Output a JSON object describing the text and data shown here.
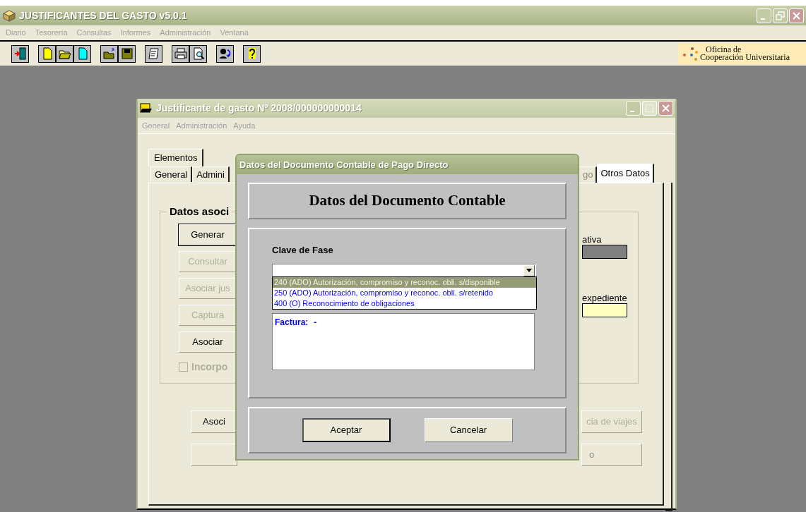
{
  "app_window": {
    "title": "JUSTIFICANTES DEL GASTO v5.0.1",
    "menu": [
      "Diario",
      "Tesorería",
      "Consultas",
      "Informes",
      "Administración",
      "Ventana"
    ],
    "toolbar": [
      {
        "kind": "exit"
      },
      {
        "kind": "new"
      },
      {
        "kind": "open"
      },
      {
        "kind": "new-alt"
      },
      {
        "kind": "folder-up"
      },
      {
        "kind": "save"
      },
      {
        "kind": "notes"
      },
      {
        "kind": "print"
      },
      {
        "kind": "preview"
      },
      {
        "kind": "users"
      },
      {
        "kind": "help"
      }
    ],
    "logo": {
      "line_1": "Oficina de",
      "line_2": "Cooperación Universitaria"
    }
  },
  "document_window": {
    "title": "Justificante de gasto Nº 2008/000000000014",
    "menu": [
      "General",
      "Administración",
      "Ayuda"
    ],
    "tabs_row_1": [
      {
        "label": "Elementos",
        "selected": false
      }
    ],
    "tabs_row_2_left": [
      {
        "label": "General",
        "selected": false
      },
      {
        "label": "Admini",
        "selected": false
      }
    ],
    "tabs_row_2_right": [
      {
        "label": "go",
        "selected": false,
        "disabled": true
      },
      {
        "label": "Otros Datos",
        "selected": true,
        "disabled": false
      }
    ],
    "group_title": "Datos asoci",
    "left_buttons": [
      {
        "label": "Generar",
        "disabled": false,
        "default": true
      },
      {
        "label": "Consultar",
        "disabled": true,
        "default": false
      },
      {
        "label": "Asociar jus",
        "disabled": true,
        "default": false
      },
      {
        "label": "Captura",
        "disabled": true,
        "default": false
      },
      {
        "label": "Asociar",
        "disabled": false,
        "default": false
      }
    ],
    "checkbox": {
      "label": "Incorpo",
      "checked": false,
      "disabled": true
    },
    "right_fields": [
      {
        "label": "ativa",
        "disabled": true
      },
      {
        "label": "expediente",
        "disabled": false
      }
    ],
    "bottom_row_1": [
      {
        "label": "Asoci",
        "disabled": false
      },
      {
        "label": "cia de viajes",
        "disabled": true
      }
    ],
    "bottom_row_2": [
      {
        "label": "o",
        "disabled": true
      }
    ]
  },
  "dialog": {
    "title": "Datos del Documento Contable de Pago Directo",
    "heading": "Datos del Documento Contable",
    "field_label": "Clave de Fase",
    "options": [
      {
        "label": "240 (ADO) Autorización, compromiso y reconoc. obli. s/disponible",
        "selected": true
      },
      {
        "label": "250 (ADO) Autorización, compromiso y reconoc. obli. s/retenido",
        "selected": false
      },
      {
        "label": "400 (O) Reconocimiento de obligaciones",
        "selected": false
      }
    ],
    "details": [
      {
        "label": "Factura:",
        "value": "-"
      }
    ],
    "buttons": [
      {
        "label": "Aceptar",
        "default": true
      },
      {
        "label": "Cancelar",
        "default": false
      }
    ]
  }
}
